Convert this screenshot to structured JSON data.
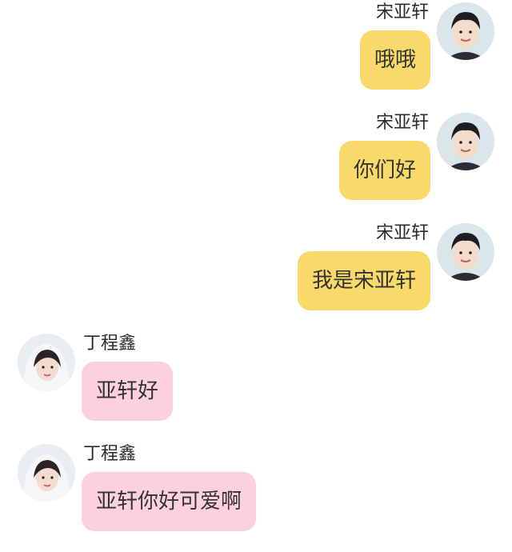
{
  "colors": {
    "right_bubble": "#fad96b",
    "left_bubble": "#fdd0dd",
    "background": "#ffffff"
  },
  "messages": [
    {
      "side": "right",
      "sender": "宋亚轩",
      "text": "哦哦",
      "avatar": "boy-avatar"
    },
    {
      "side": "right",
      "sender": "宋亚轩",
      "text": "你们好",
      "avatar": "boy-avatar"
    },
    {
      "side": "right",
      "sender": "宋亚轩",
      "text": "我是宋亚轩",
      "avatar": "boy-avatar"
    },
    {
      "side": "left",
      "sender": "丁程鑫",
      "text": "亚轩好",
      "avatar": "girl-avatar"
    },
    {
      "side": "left",
      "sender": "丁程鑫",
      "text": "亚轩你好可爱啊",
      "avatar": "girl-avatar"
    }
  ]
}
